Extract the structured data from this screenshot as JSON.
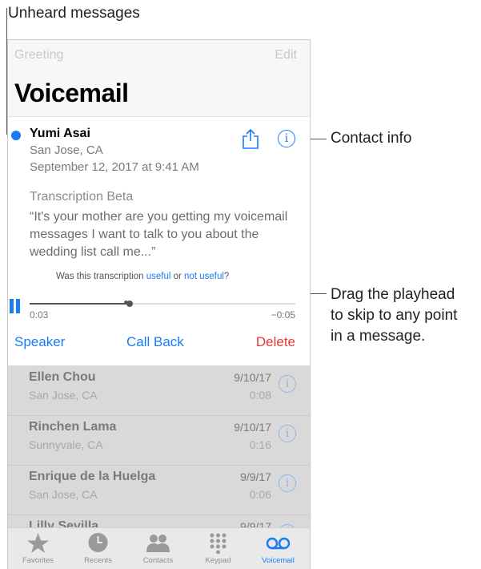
{
  "callouts": {
    "unheard": "Unheard messages",
    "contact": "Contact info",
    "playhead_line1": "Drag the playhead",
    "playhead_line2": "to skip to any point",
    "playhead_line3": "in a message."
  },
  "nav": {
    "greeting": "Greeting",
    "edit": "Edit",
    "title": "Voicemail"
  },
  "message": {
    "name": "Yumi Asai",
    "location": "San Jose, CA",
    "datetime": "September 12, 2017 at 9:41 AM",
    "transcription_title": "Transcription Beta",
    "transcription_text": "“It's your mother are you getting my voicemail messages I want to talk to you about the wedding list call me...”",
    "feedback_prefix": "Was this transcription",
    "feedback_useful": "useful",
    "feedback_or": "or",
    "feedback_not_useful": "not useful",
    "feedback_suffix": "?",
    "elapsed": "0:03",
    "remaining": "−0:05",
    "progress": 0.375
  },
  "actions": {
    "speaker": "Speaker",
    "call_back": "Call Back",
    "delete": "Delete"
  },
  "list": [
    {
      "name": "Ellen Chou",
      "location": "San Jose, CA",
      "date": "9/10/17",
      "duration": "0:08"
    },
    {
      "name": "Rinchen Lama",
      "location": "Sunnyvale, CA",
      "date": "9/10/17",
      "duration": "0:16"
    },
    {
      "name": "Enrique de la Huelga",
      "location": "San Jose, CA",
      "date": "9/9/17",
      "duration": "0:06"
    },
    {
      "name": "Lilly Sevilla",
      "location": "",
      "date": "9/9/17",
      "duration": ""
    }
  ],
  "tabs": [
    {
      "label": "Favorites",
      "icon": "star-icon"
    },
    {
      "label": "Recents",
      "icon": "clock-icon"
    },
    {
      "label": "Contacts",
      "icon": "contacts-icon"
    },
    {
      "label": "Keypad",
      "icon": "keypad-icon"
    },
    {
      "label": "Voicemail",
      "icon": "voicemail-icon"
    }
  ],
  "colors": {
    "accent": "#1a7cf5",
    "delete": "#e6373a",
    "unheard_dot": "#1a7cf5"
  }
}
